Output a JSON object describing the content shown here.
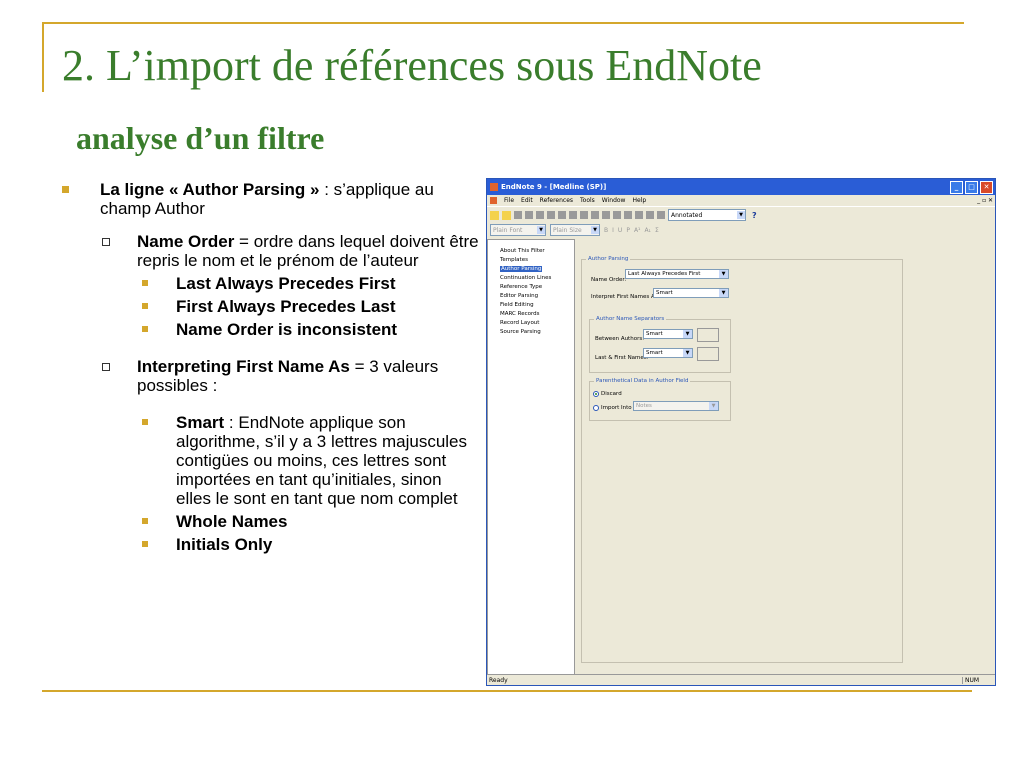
{
  "slide": {
    "title": "2. L’import de références sous EndNote",
    "subtitle": "analyse d’un filtre"
  },
  "content": {
    "b1": {
      "bold": "La ligne « Author Parsing » ",
      "rest": ": s’applique au champ Author"
    },
    "name_order": {
      "bold": "Name Order",
      "rest": " = ordre dans lequel doivent être repris le nom et le prénom de l’auteur"
    },
    "name_order_options": [
      "Last Always Precedes First",
      "First Always Precedes Last",
      "Name Order is inconsistent"
    ],
    "interpreting": {
      "bold": "Interpreting First Name As",
      "rest": " = 3 valeurs possibles :"
    },
    "smart": {
      "bold": "Smart",
      "rest": " : EndNote applique son algorithme, s’il y a 3 lettres majuscules contigües ou moins, ces lettres sont importées en tant qu’initiales, sinon elles le sont en tant que nom complet"
    },
    "whole_names": "Whole Names",
    "initials_only": "Initials Only"
  },
  "window": {
    "title": "EndNote 9 - [Medline (SP)]",
    "menu": [
      "File",
      "Edit",
      "References",
      "Tools",
      "Window",
      "Help"
    ],
    "style_combo": "Annotated",
    "help_label": "?",
    "font_combo": "Plain Font",
    "size_combo": "Plain Size",
    "format_buttons": [
      "B",
      "I",
      "U",
      "P",
      "A¹",
      "A₁",
      "Σ"
    ],
    "tree": [
      "About This Filter",
      "Templates",
      "Author Parsing",
      "Continuation Lines",
      "Reference Type",
      "Editor Parsing",
      "Field Editing",
      "MARC Records",
      "Record Layout",
      "Source Parsing"
    ],
    "active_tree_index": 2,
    "author_parsing_group": "Author Parsing",
    "name_order_label": "Name Order:",
    "name_order_value": "Last Always Precedes First",
    "interpret_label": "Interpret First Names As:",
    "interpret_value": "Smart",
    "separators_group": "Author Name Separators",
    "between_label": "Between Authors:",
    "between_value": "Smart",
    "lastfirst_label": "Last & First Names:",
    "lastfirst_value": "Smart",
    "paren_group": "Parenthetical Data in Author Field",
    "discard_label": "Discard",
    "import_label": "Import Into",
    "import_value": "Notes",
    "status_left": "Ready",
    "status_right": "NUM"
  }
}
